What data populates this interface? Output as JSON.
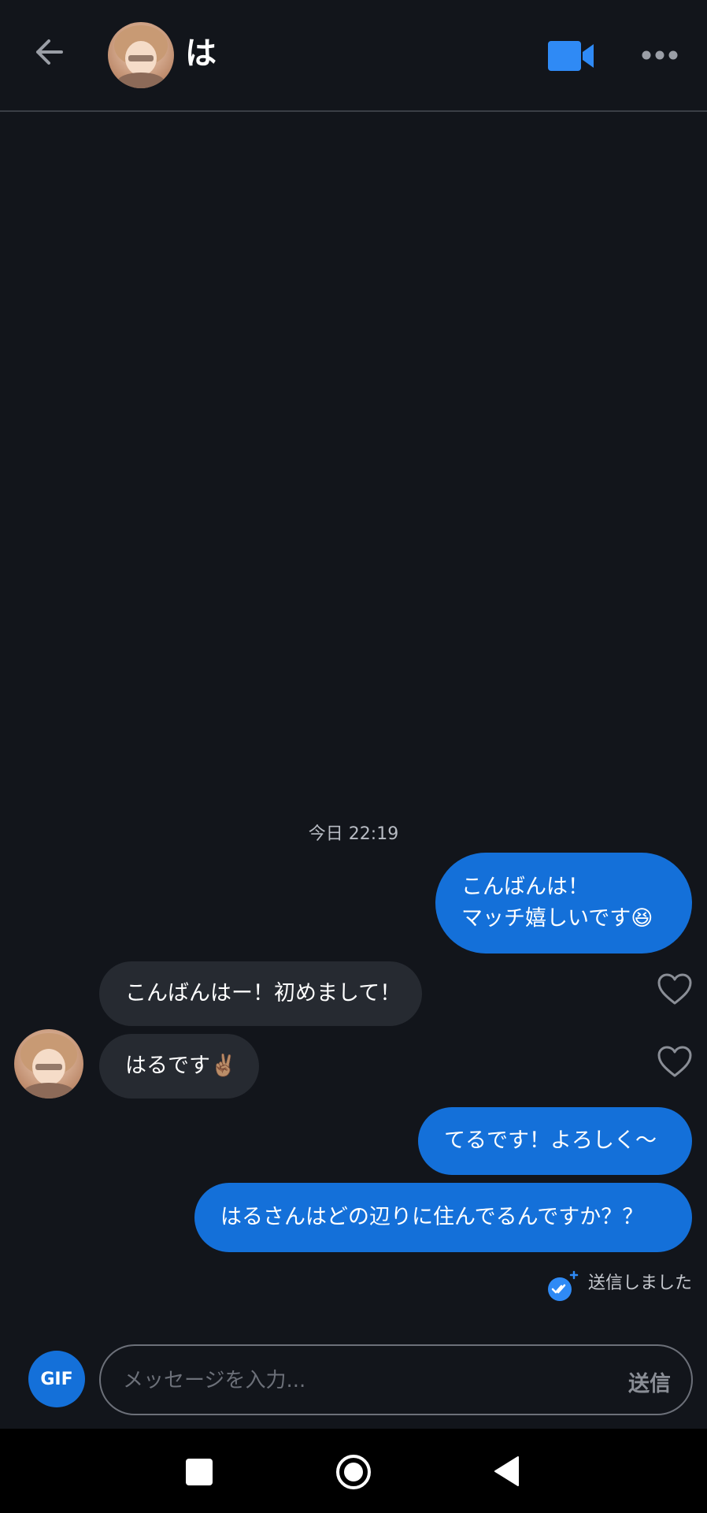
{
  "header": {
    "contact_name": "は",
    "icons": {
      "back": "arrow-left-icon",
      "video": "video-camera-icon",
      "more": "more-horizontal-icon"
    }
  },
  "chat": {
    "timestamp": "今日 22:19",
    "messages": [
      {
        "side": "out",
        "lines": [
          "こんばんは！",
          "マッチ嬉しいです😆"
        ]
      },
      {
        "side": "in",
        "text": "こんばんはー！初めまして！"
      },
      {
        "side": "in",
        "text": "はるです✌🏽"
      },
      {
        "side": "out",
        "text": "てるです！よろしく〜"
      },
      {
        "side": "out",
        "text": "はるさんはどの辺りに住んでるんですか？？"
      }
    ],
    "status_text": "送信しました"
  },
  "composer": {
    "gif_label": "GIF",
    "placeholder": "メッセージを入力...",
    "send_label": "送信"
  },
  "colors": {
    "background": "#12151b",
    "outgoing_bubble": "#1470d9",
    "incoming_bubble": "#262a31",
    "accent": "#2f8af5"
  }
}
